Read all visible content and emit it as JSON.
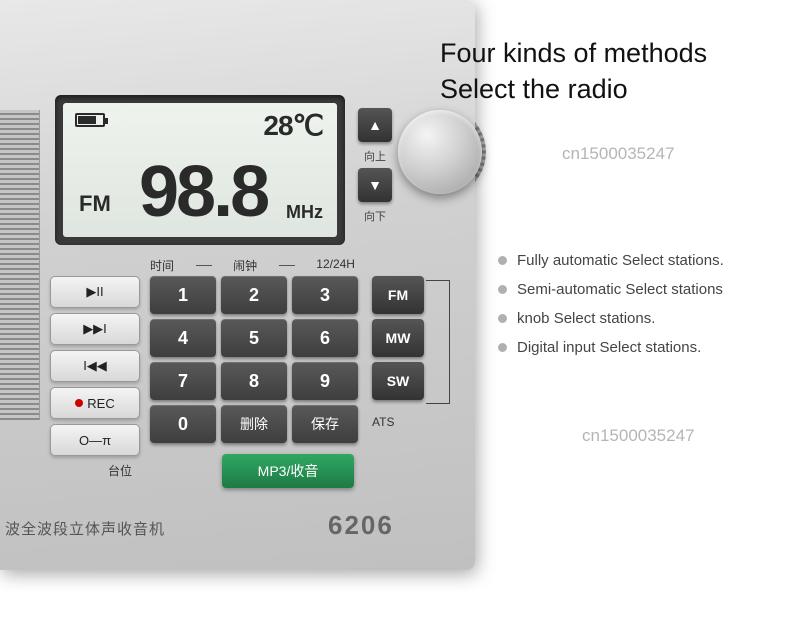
{
  "heading_line1": "Four kinds of methods",
  "heading_line2": "Select the radio",
  "watermark": "cn1500035247",
  "features": [
    "Fully automatic Select stations.",
    "Semi-automatic Select stations",
    "knob Select stations.",
    "Digital input Select stations."
  ],
  "lcd": {
    "temperature": "28",
    "temp_unit": "℃",
    "band": "FM",
    "frequency": "98.8",
    "freq_unit": "MHz"
  },
  "keypad_header": {
    "time": "时间",
    "alarm": "闹钟",
    "format": "12/24H"
  },
  "keys": [
    "1",
    "2",
    "3",
    "4",
    "5",
    "6",
    "7",
    "8",
    "9",
    "0",
    "删除",
    "保存"
  ],
  "left_buttons": {
    "play_pause": "▶II",
    "next": "▶▶I",
    "prev": "I◀◀",
    "rec": "REC",
    "lock": "O—π"
  },
  "band_buttons": [
    "FM",
    "MW",
    "SW"
  ],
  "ats_label": "ATS",
  "mp3_label": "MP3/收音",
  "station_label": "台位",
  "up_label": "向上",
  "down_label": "向下",
  "bottom_text": "波全波段立体声收音机",
  "model": "6206"
}
